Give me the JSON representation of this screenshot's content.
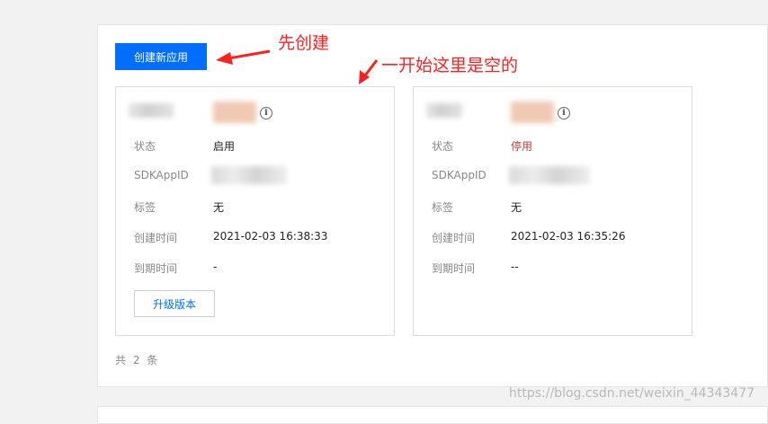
{
  "toolbar": {
    "create_label": "创建新应用"
  },
  "annotations": {
    "create_note": "先创建",
    "empty_note": "一开始这里是空的"
  },
  "labels": {
    "status": "状态",
    "sdkappid": "SDKAppID",
    "tags": "标签",
    "created_time": "创建时间",
    "expire_time": "到期时间"
  },
  "apps": [
    {
      "status": "启用",
      "status_color": "#222222",
      "tags": "无",
      "created_time": "2021-02-03 16:38:33",
      "expire_time": "-",
      "upgrade_label": "升级版本"
    },
    {
      "status": "停用",
      "status_color": "#c33a3a",
      "tags": "无",
      "created_time": "2021-02-03 16:35:26",
      "expire_time": "--"
    }
  ],
  "pagination": {
    "total_text": "共 2 条"
  },
  "watermark": "https://blog.csdn.net/weixin_44343477",
  "colors": {
    "primary": "#006eff",
    "annotation": "#ff1f1f"
  },
  "icons": {
    "info": "info-circle-icon"
  }
}
